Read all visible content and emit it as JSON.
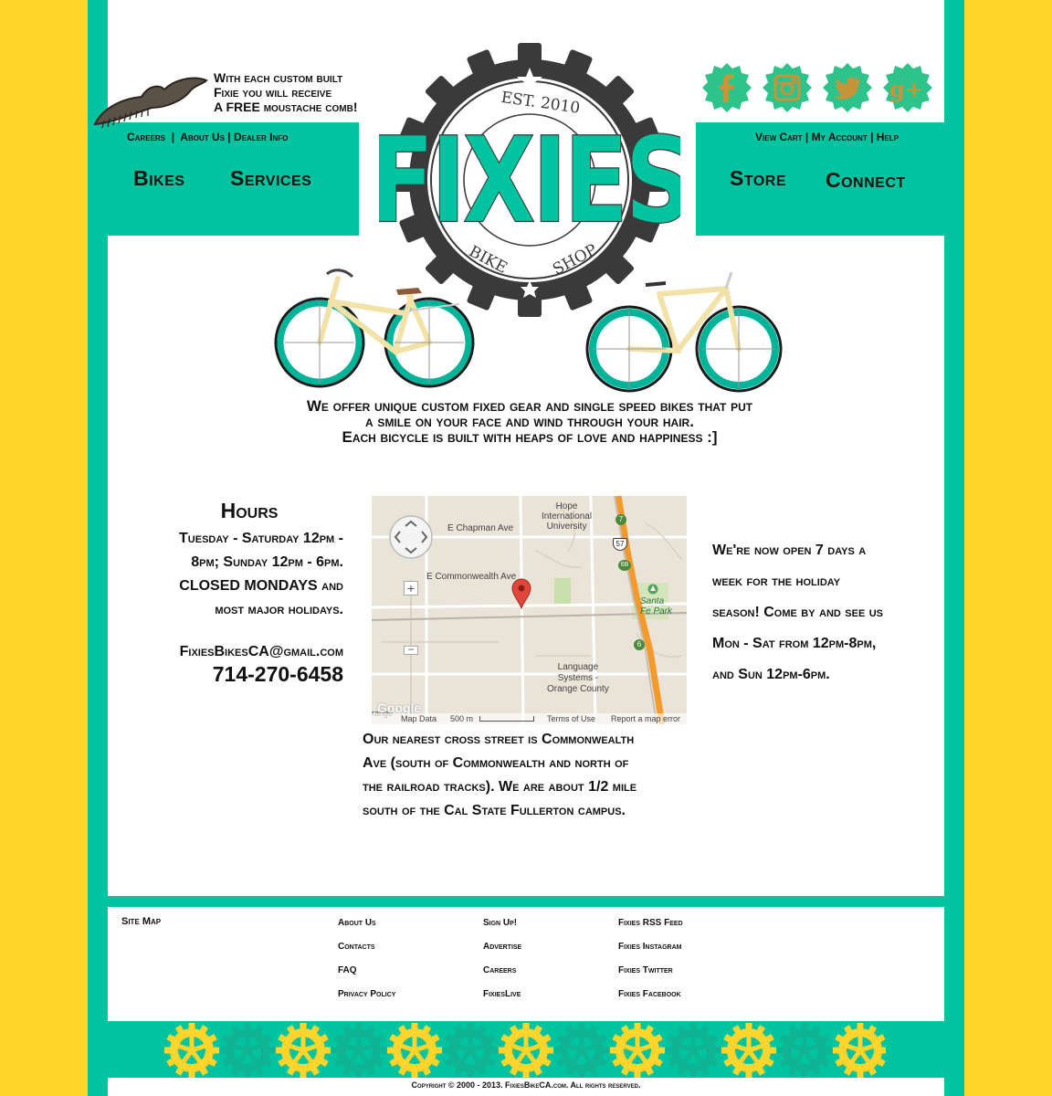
{
  "promo": {
    "line1": "With each custom built",
    "line2": "Fixie you will receive",
    "line3": "A  FREE moustache comb!"
  },
  "nav_left_links": [
    "Careers",
    "About Us",
    "Dealer Info"
  ],
  "nav_right_links": [
    "View Cart",
    "My Account",
    "Help"
  ],
  "main_nav": {
    "bikes": "Bikes",
    "services": "Services",
    "store": "Store",
    "connect": "Connect"
  },
  "logo": {
    "est": "EST. 2010",
    "name": "FIXIES",
    "bike": "BIKE",
    "shop": "SHOP"
  },
  "social": [
    "facebook-icon",
    "instagram-icon",
    "twitter-icon",
    "google-plus-icon"
  ],
  "tagline": {
    "line1": "We offer unique custom fixed gear and single speed bikes that put",
    "line2": "a smile on your face and wind through your hair.",
    "line3": "Each bicycle is built with heaps of love and happiness :]"
  },
  "hours": {
    "title": "Hours",
    "line1": "Tuesday - Saturday 12pm -",
    "line2": "8pm;  Sunday 12pm - 6pm.",
    "line3": "CLOSED MONDAYS and",
    "line4": "most major holidays.",
    "email": "FixiesBikesCA@gmail.com",
    "phone": "714-270-6458"
  },
  "map": {
    "labels": {
      "chapman": "E Chapman Ave",
      "commonwealth": "E Commonwealth Ave",
      "hope1": "Hope",
      "hope2": "International",
      "hope3": "University",
      "santafe1": "Santa",
      "santafe2": "Fe Park",
      "lang1": "Language",
      "lang2": "Systems -",
      "lang3": "Orange County",
      "orange": "range",
      "google": "Google"
    },
    "route_57": "57",
    "route_7": "7",
    "route_6b": "6B",
    "route_6": "6",
    "map_data": "Map Data",
    "scale": "500 m",
    "terms": "Terms of Use",
    "report": "Report a map error"
  },
  "crossstreet": {
    "line1": "Our nearest cross street is Commonwealth",
    "line2": "Ave (south of Commonwealth and north of",
    "line3": "the railroad tracks).  We are about 1/2 mile",
    "line4": "south of the Cal State Fullerton campus."
  },
  "holiday": {
    "line1": "We're now open 7 days a",
    "line2": "week for the holiday",
    "line3": "season! Come by and see us",
    "line4": "Mon - Sat from 12pm-8pm,",
    "line5": "and Sun 12pm-6pm."
  },
  "footer": {
    "sitemap": "Site Map",
    "col1": [
      "About Us",
      "Contacts",
      "FAQ",
      "Privacy Policy"
    ],
    "col2": [
      "Sign Up!",
      "Advertise",
      "Careers",
      "FixiesLive"
    ],
    "col3": [
      "Fixies RSS Feed",
      "Fixies Instagram",
      "Fixies Twitter",
      "Fixies Facebook"
    ]
  },
  "copyright": "Copyright © 2000 - 2013. FixiesBikeCA.com. All rights reserved.",
  "colors": {
    "teal": "#00c3a0",
    "yellow": "#ffd52b",
    "gear_dark": "#3a3a3a",
    "social_green": "#29c48e"
  }
}
